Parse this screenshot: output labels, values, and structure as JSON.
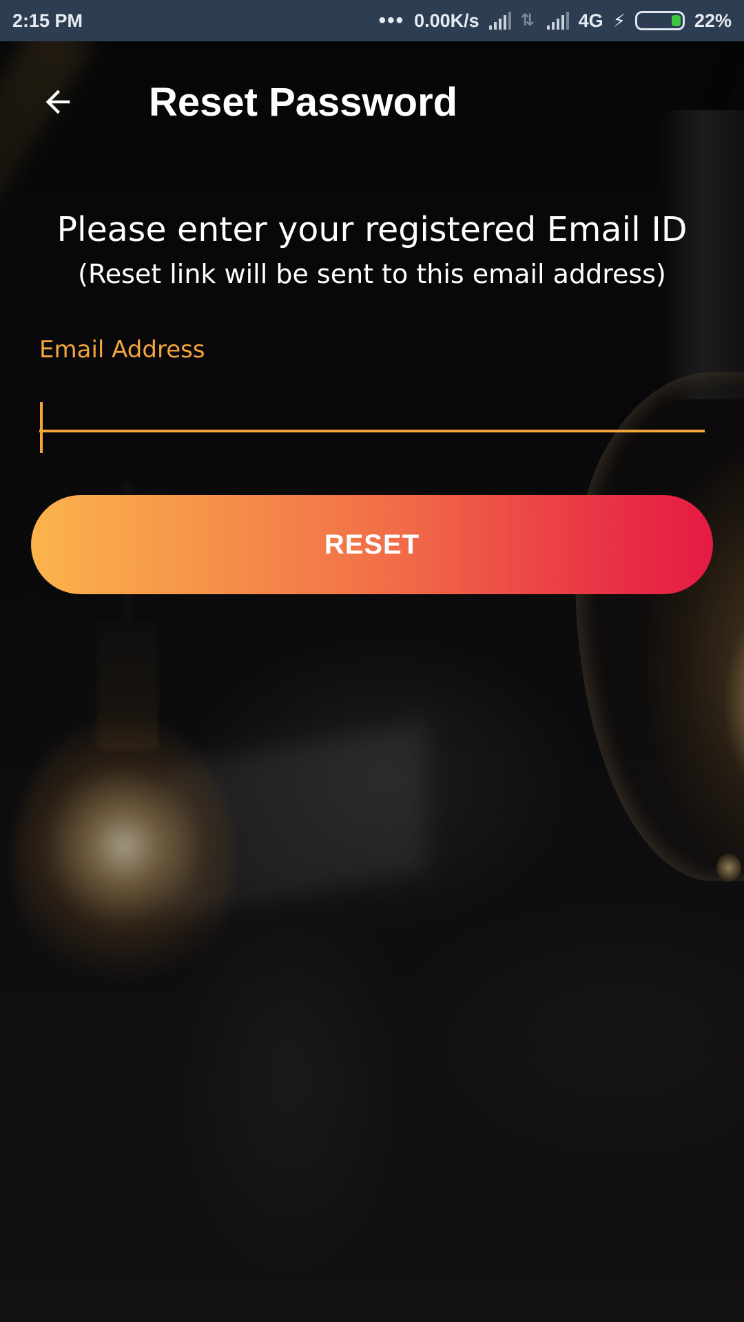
{
  "status_bar": {
    "time": "2:15 PM",
    "more_indicator": "•••",
    "net_speed": "0.00K/s",
    "network": "4G",
    "battery": "22%",
    "battery_level": 0.22,
    "icons": [
      "signal-icon",
      "data-arrows-icon",
      "signal-icon",
      "charging-icon",
      "battery-icon"
    ]
  },
  "header": {
    "back_icon": "arrow-left-icon",
    "title": "Reset Password"
  },
  "instructions": {
    "main": "Please enter your registered Email ID",
    "sub": "(Reset link will be sent to this email address)"
  },
  "email_field": {
    "label": "Email Address",
    "value": "",
    "placeholder": ""
  },
  "reset_button": {
    "label": "RESET"
  },
  "colors": {
    "accent": "#f4a53c",
    "status_bar": "#2e3e52",
    "button_gradient_start": "#fbb44c",
    "button_gradient_end": "#e51a44"
  }
}
